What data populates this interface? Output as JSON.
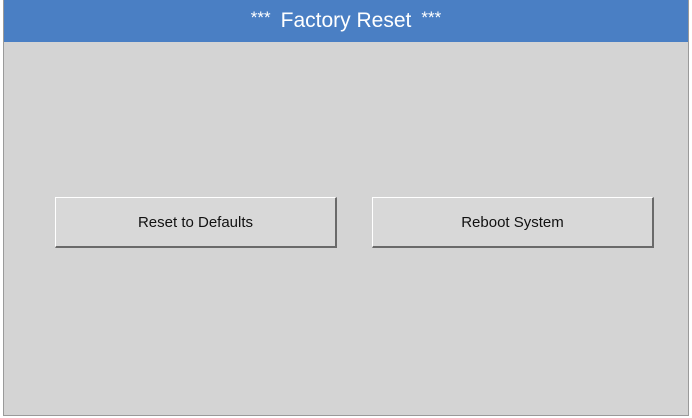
{
  "header": {
    "stars_left": "***",
    "title": "Factory Reset",
    "stars_right": "***"
  },
  "actions": {
    "reset_label": "Reset to Defaults",
    "reboot_label": "Reboot System"
  },
  "colors": {
    "header_bg": "#4a7fc4",
    "screen_bg": "#d4d4d4",
    "button_bg": "#d8d8d8"
  }
}
